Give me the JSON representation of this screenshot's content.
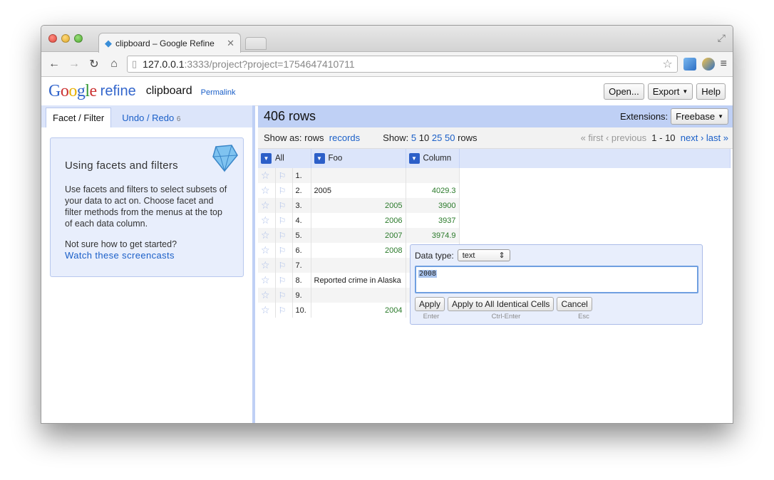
{
  "browser": {
    "tab_title": "clipboard – Google Refine",
    "url_host": "127.0.0.1",
    "url_rest": ":3333/project?project=1754647410711"
  },
  "app": {
    "logo_refine": "refine",
    "project_name": "clipboard",
    "permalink": "Permalink",
    "buttons": {
      "open": "Open...",
      "export": "Export",
      "help": "Help"
    }
  },
  "left": {
    "tab_facet": "Facet / Filter",
    "tab_undo": "Undo / Redo",
    "undo_count": "6",
    "help_title": "Using facets and filters",
    "help_text": "Use facets and filters to select subsets of your data to act on. Choose facet and filter methods from the menus at the top of each data column.",
    "help_question": "Not sure how to get started?",
    "help_link": "Watch these screencasts"
  },
  "right": {
    "row_count": "406 rows",
    "extensions_label": "Extensions:",
    "freebase": "Freebase",
    "show_as": "Show as:",
    "rows_mode": "rows",
    "records_mode": "records",
    "show": "Show:",
    "page_sizes": [
      "5",
      "10",
      "25",
      "50"
    ],
    "rows_word": "rows",
    "first": "« first",
    "previous": "‹ previous",
    "range": "1 - 10",
    "next": "next ›",
    "last": "last »",
    "columns": {
      "all": "All",
      "foo": "Foo",
      "column": "Column"
    },
    "rows": [
      {
        "n": "1.",
        "foo": "",
        "col": ""
      },
      {
        "n": "2.",
        "foo": "2005",
        "col": "4029.3"
      },
      {
        "n": "3.",
        "foo": "2005",
        "col": "3900"
      },
      {
        "n": "4.",
        "foo": "2006",
        "col": "3937"
      },
      {
        "n": "5.",
        "foo": "2007",
        "col": "3974.9"
      },
      {
        "n": "6.",
        "foo": "2008",
        "col": ""
      },
      {
        "n": "7.",
        "foo": "",
        "col": ""
      },
      {
        "n": "8.",
        "foo": "Reported crime in Alaska",
        "col": ""
      },
      {
        "n": "9.",
        "foo": "",
        "col": ""
      },
      {
        "n": "10.",
        "foo": "2004",
        "col": ""
      }
    ]
  },
  "editor": {
    "data_type_label": "Data type:",
    "data_type": "text",
    "value": "2008",
    "apply": "Apply",
    "apply_all": "Apply to All Identical Cells",
    "cancel": "Cancel",
    "hint_enter": "Enter",
    "hint_ctrl": "Ctrl-Enter",
    "hint_esc": "Esc"
  }
}
